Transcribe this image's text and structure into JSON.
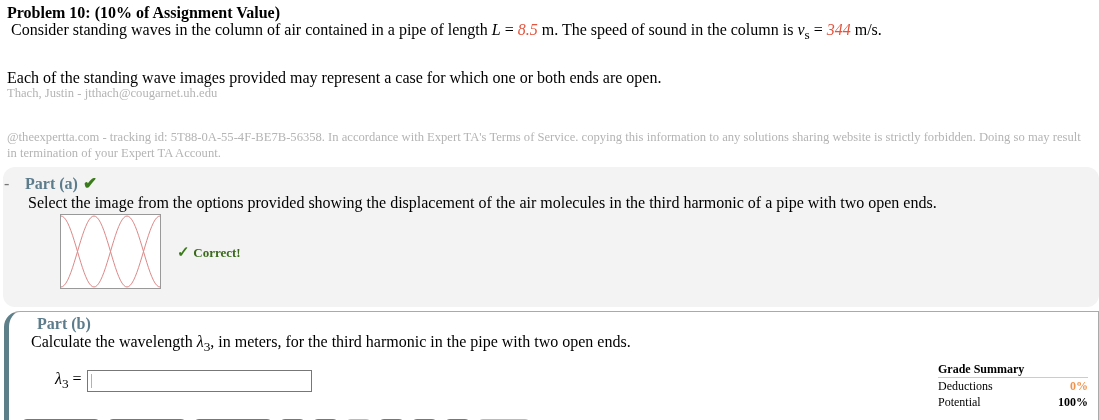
{
  "problem": {
    "title": "Problem 10: (10% of Assignment Value)",
    "intro": [
      {
        "kind": "plain",
        "text": "Consider standing waves in the column of air contained in a pipe of length *L* = "
      },
      {
        "kind": "given",
        "text": "8.5"
      },
      {
        "kind": "plain",
        "text": " m. The speed of sound in the column is *v*$_{s}$ = "
      },
      {
        "kind": "given",
        "text": "344"
      },
      {
        "kind": "plain",
        "text": " m/s."
      }
    ],
    "note": "Each of the standing wave images provided may represent a case for which one or both ends are open.",
    "student": "Thach, Justin - jtthach@cougarnet.uh.edu",
    "tracking": "@theexpertta.com - tracking id: 5T88-0A-55-4F-BE7B-56358. In accordance with Expert TA's Terms of Service. copying this information to any solutions sharing website is strictly forbidden. Doing so may result in termination of your Expert TA Account."
  },
  "part_a": {
    "toggle": "-",
    "label": "Part (a)",
    "status": "✔",
    "question": "Select the image from the options provided showing the displacement of the air molecules in the third harmonic of a pipe with two open ends.",
    "feedback_mark": "✓",
    "feedback": "Correct!"
  },
  "part_b": {
    "label": "Part (b)",
    "question": "Calculate the wavelength *λ*$_{3}$, in meters, for the third harmonic in the pipe with two open ends.",
    "answer_label": "*λ*$_{3}$ =",
    "answer_focused": true,
    "grade_summary": {
      "title": "Grade Summary",
      "rows": [
        {
          "kind": "deduction",
          "label": "Deductions",
          "value": "0%"
        },
        {
          "kind": "potential",
          "label": "Potential",
          "value": "100%"
        }
      ]
    },
    "keypad": [
      {
        "kind": "wide",
        "disabled": false
      },
      {
        "kind": "wide",
        "disabled": false
      },
      {
        "kind": "wide",
        "disabled": false
      },
      {
        "kind": "narrow",
        "disabled": false
      },
      {
        "kind": "narrow",
        "disabled": false
      },
      {
        "kind": "narrow",
        "disabled": true
      },
      {
        "kind": "narrow",
        "disabled": false
      },
      {
        "kind": "narrow",
        "disabled": false
      },
      {
        "kind": "narrow",
        "disabled": false
      },
      {
        "kind": "medium",
        "disabled": true
      }
    ]
  }
}
